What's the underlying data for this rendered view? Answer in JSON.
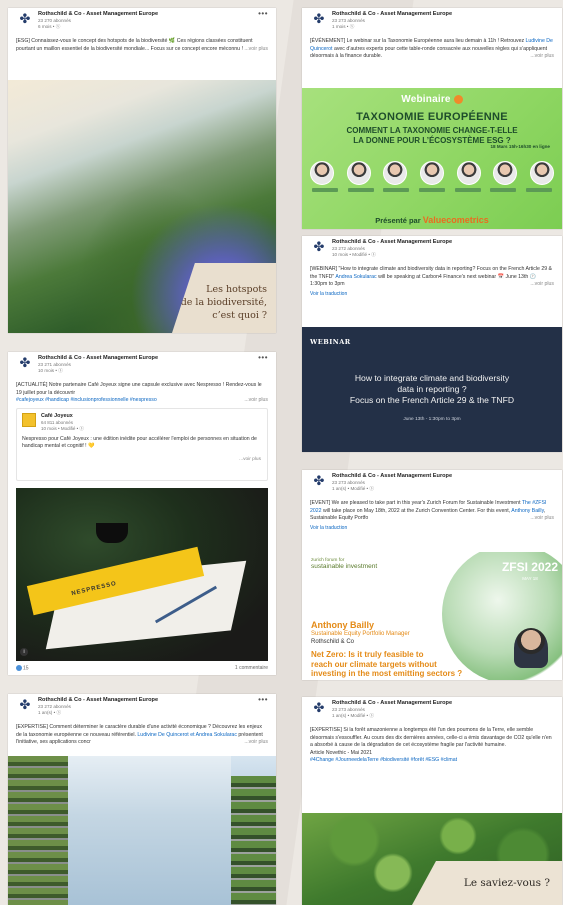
{
  "brand": {
    "logo_icon": "rothschild-eagle-icon"
  },
  "cards": [
    {
      "author": "Rothschild & Co - Asset Management Europe",
      "followers": "23 270 abonnés",
      "time": "6 mois • ⓢ",
      "text": "[ESG] Connaissez-vous le concept des hotspots de la biodiversité 🌿 Ces régions classées constituent pourtant un maillon essentiel de la biodiversité mondiale... Focus sur ce concept encore méconnu !",
      "more": "...voir plus",
      "image_caption_1": "Les hotspots",
      "image_caption_2": "de la biodiversité,",
      "image_caption_3": "c’est quoi ?"
    },
    {
      "author": "Rothschild & Co - Asset Management Europe",
      "followers": "23 273 abonnés",
      "time": "1 mois • ⓢ",
      "text_a": "[ÉVÉNEMENT] Le webinar sur la Taxonomie Européenne aura lieu demain à 11h ! Retrouvez ",
      "text_link": "Ludivine De Quincerot",
      "text_b": " avec d’autres experts pour cette table-ronde consacrée aux nouvelles règles qui s’appliquent désormais à la finance durable.",
      "more": "...voir plus",
      "webinar_label": "Webinaire",
      "title": "TAXONOMIE EUROPÉENNE",
      "subtitle_1": "COMMENT LA TAXONOMIE CHANGE-T-ELLE",
      "subtitle_2": "LA DONNE POUR L’ÉCOSYSTÈME ESG ?",
      "date": "18 Mars 15h-16h30 en ligne",
      "presented_by": "Présenté par",
      "presenter": "Valuecometrics"
    },
    {
      "author": "Rothschild & Co - Asset Management Europe",
      "followers": "23 272 abonnés",
      "time": "10 mois • Modifié • ⓢ",
      "text_a": "[WEBINAR] \"How to integrate climate and biodiversity data in reporting? Focus on the French Article 29 & the TNFD\" ",
      "text_link": "Andrea Sokularac",
      "text_b": " will be speaking at Carbon4 Finance's next webinar 📅 June 13th 🕐 1:30pm to 3pm",
      "more": "...voir plus",
      "translate": "Voir la traduction",
      "label": "WEBINAR",
      "title_1": "How to integrate climate and biodiversity",
      "title_2": "data in reporting ?",
      "title_3": "Focus on the French Article 29 & the TNFD",
      "time_range": "June 13th - 1:30pm to 3pm"
    },
    {
      "author": "Rothschild & Co - Asset Management Europe",
      "followers": "23 271 abonnés",
      "time": "10 mois • ⓢ",
      "text": "[ACTUALITÉ] Notre partenaire Café Joyeux signe une capsule exclusive avec Nespresso ! Rendez-vous le 19 juillet pour la découvrir",
      "hashtags": "#cafejoyeux #handicap #inclusionprofessionnelle #nespresso",
      "more": "...voir plus",
      "shared_author": "Café Joyeux",
      "shared_followers": "64 811 abonnés",
      "shared_time": "10 mois • Modifié • ⓢ",
      "shared_text": "Nespresso pour Café Joyeux : une édition inédite pour accélérer l'emploi de personnes en situation de handicap mental et cognitif ! 💛",
      "shared_more": "...voir plus",
      "product_label": "NESPRESSO",
      "reactions": "15",
      "comments": "1 commentaire"
    },
    {
      "author": "Rothschild & Co - Asset Management Europe",
      "followers": "23 273 abonnés",
      "time": "1 an(s) • Modifié • ⓢ",
      "text_a": "[EVENT] We are pleased to take part in this year's Zurich Forum for Sustainable Investment ",
      "text_link_1": "The #ZFSI 2022",
      "text_b": " will take place on May 18th, 2022 at the Zurich Convention Center. For this event, ",
      "text_link_2": "Anthony Bailly",
      "text_c": ", Sustainable Equity Portfo",
      "more": "...voir plus",
      "translate": "Voir la traduction",
      "forum_small": "zurich forum for",
      "forum_big": "sustainable investment",
      "badge": "ZFSI 2022",
      "badge_sub": "MAY 18",
      "speaker": "Anthony Bailly",
      "role": "Sustainable Equity Portfolio Manager",
      "org": "Rothschild & Co",
      "question_1": "Net Zero: Is it truly feasible to",
      "question_2": "reach our climate targets without",
      "question_3": "investing in the most emitting sectors ?"
    },
    {
      "author": "Rothschild & Co - Asset Management Europe",
      "followers": "23 272 abonnés",
      "time": "1 an(s) • ⓢ",
      "text_a": "[EXPERTISE] Comment déterminer le caractère durable d'une activité économique ? Découvrez les enjeux de la taxonomie européenne ce nouveau référentiel. ",
      "text_link": "Ludivine De Quincerot et Andrea Sokularac",
      "text_b": " présentent l'initiative, ses applications concr",
      "more": "...voir plus"
    },
    {
      "author": "Rothschild & Co - Asset Management Europe",
      "followers": "23 273 abonnés",
      "time": "1 an(s) • Modifié • ⓢ",
      "text": "[EXPERTISE] Si la forêt amazonienne a longtemps été l'un des poumons de la Terre, elle semble désormais s'essouffler. Au cours des dix dernières années, celle-ci a émis davantage de CO2 qu'elle n'en a absorbé à cause de la dégradation de cet écosystème fragile par l'activité humaine.",
      "source": "Article Novethic - Mai 2021",
      "hashtags": "#4Change #JourneedelaTerre #biodiversité #forêt #ESG #climat",
      "caption": "Le saviez-vous ?"
    }
  ],
  "menu_glyph": "•••"
}
